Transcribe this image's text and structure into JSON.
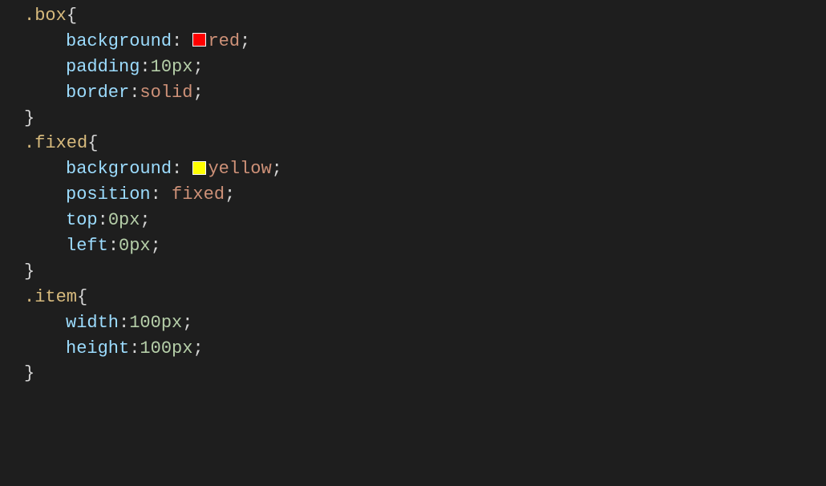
{
  "css_rules": [
    {
      "selector": ".box",
      "declarations": [
        {
          "property": "background",
          "value_prefix_space": " ",
          "swatch": "red",
          "value": "red"
        },
        {
          "property": "padding",
          "number": "10",
          "unit": "px"
        },
        {
          "property": "border",
          "value": "solid"
        }
      ]
    },
    {
      "selector": ".fixed",
      "declarations": [
        {
          "property": "background",
          "value_prefix_space": " ",
          "swatch": "yellow",
          "value": "yellow"
        },
        {
          "property": "position",
          "value_prefix_space": " ",
          "value": "fixed"
        },
        {
          "property": "top",
          "number": "0",
          "unit": "px"
        },
        {
          "property": "left",
          "number": "0",
          "unit": "px"
        }
      ]
    },
    {
      "selector": ".item",
      "declarations": [
        {
          "property": "width",
          "number": "100",
          "unit": "px"
        },
        {
          "property": "height",
          "number": "100",
          "unit": "px"
        }
      ]
    }
  ],
  "colors": {
    "red": "#ff0000",
    "yellow": "#ffff00"
  }
}
